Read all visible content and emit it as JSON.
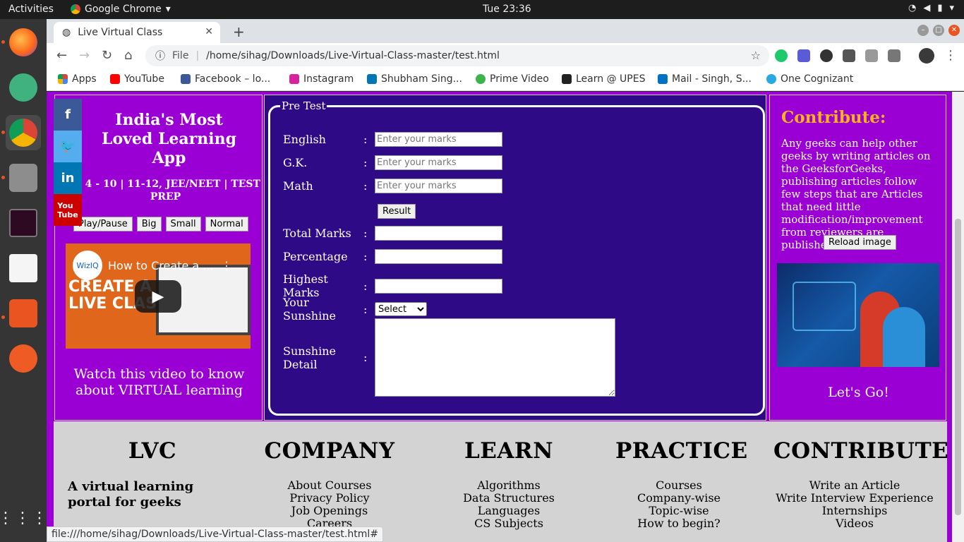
{
  "topbar": {
    "activities": "Activities",
    "app": "Google Chrome",
    "clock": "Tue 23:36"
  },
  "chrome": {
    "tab_title": "Live Virtual Class",
    "url_scheme": "File",
    "url": "/home/sihag/Downloads/Live-Virtual-Class-master/test.html",
    "bookmarks": [
      "Apps",
      "YouTube",
      "Facebook – lo...",
      "Instagram",
      "Shubham Sing...",
      "Prime Video",
      "Learn @ UPES",
      "Mail - Singh, S...",
      "One Cognizant"
    ],
    "status_url": "file:///home/sihag/Downloads/Live-Virtual-Class-master/test.html#"
  },
  "left": {
    "title": "India's Most Loved Learning App",
    "subtitle": "ss 4 - 10 | 11-12, JEE/NEET | TEST PREP",
    "buttons": [
      "Play/Pause",
      "Big",
      "Small",
      "Normal"
    ],
    "video_title": "How to Create a ...",
    "video_logo": "WizIQ",
    "video_overlay": "CREATE A\nLIVE CLAS",
    "watch": "Watch this video to know about VIRTUAL learning"
  },
  "pretest": {
    "legend": "Pre Test",
    "fields": [
      {
        "label": "English",
        "placeholder": "Enter your marks"
      },
      {
        "label": "G.K.",
        "placeholder": "Enter your marks"
      },
      {
        "label": "Math",
        "placeholder": "Enter your marks"
      }
    ],
    "result_button": "Result",
    "outputs": [
      "Total Marks",
      "Percentage",
      "Highest Marks"
    ],
    "sunshine_label": "Your Sunshine",
    "sunshine_select": "Select",
    "sunshine_detail_label": "Sunshine Detail",
    "colon": ":"
  },
  "right": {
    "heading": "Contribute:",
    "text": "Any geeks can help other geeks by writing articles on the GeeksforGeeks, publishing articles follow few steps that are Articles that need little modification/improvement from reviewers are published first.",
    "reload": "Reload image",
    "go": "Let's Go!"
  },
  "footer": {
    "lvc": {
      "title": "LVC",
      "tagline": "A virtual learning portal for geeks"
    },
    "company": {
      "title": "COMPANY",
      "items": [
        "About Courses",
        "Privacy Policy",
        "Job Openings",
        "Careers"
      ]
    },
    "learn": {
      "title": "LEARN",
      "items": [
        "Algorithms",
        "Data Structures",
        "Languages",
        "CS Subjects"
      ]
    },
    "practice": {
      "title": "PRACTICE",
      "items": [
        "Courses",
        "Company-wise",
        "Topic-wise",
        "How to begin?"
      ]
    },
    "contribute": {
      "title": "CONTRIBUTE",
      "items": [
        "Write an Article",
        "Write Interview Experience",
        "Internships",
        "Videos"
      ]
    }
  },
  "colors": {
    "page_bg": "#9a00d4",
    "pretest_bg": "#2e0a86",
    "contribute_heading": "#ffb21b",
    "footer_bg": "#d3d3d3"
  }
}
